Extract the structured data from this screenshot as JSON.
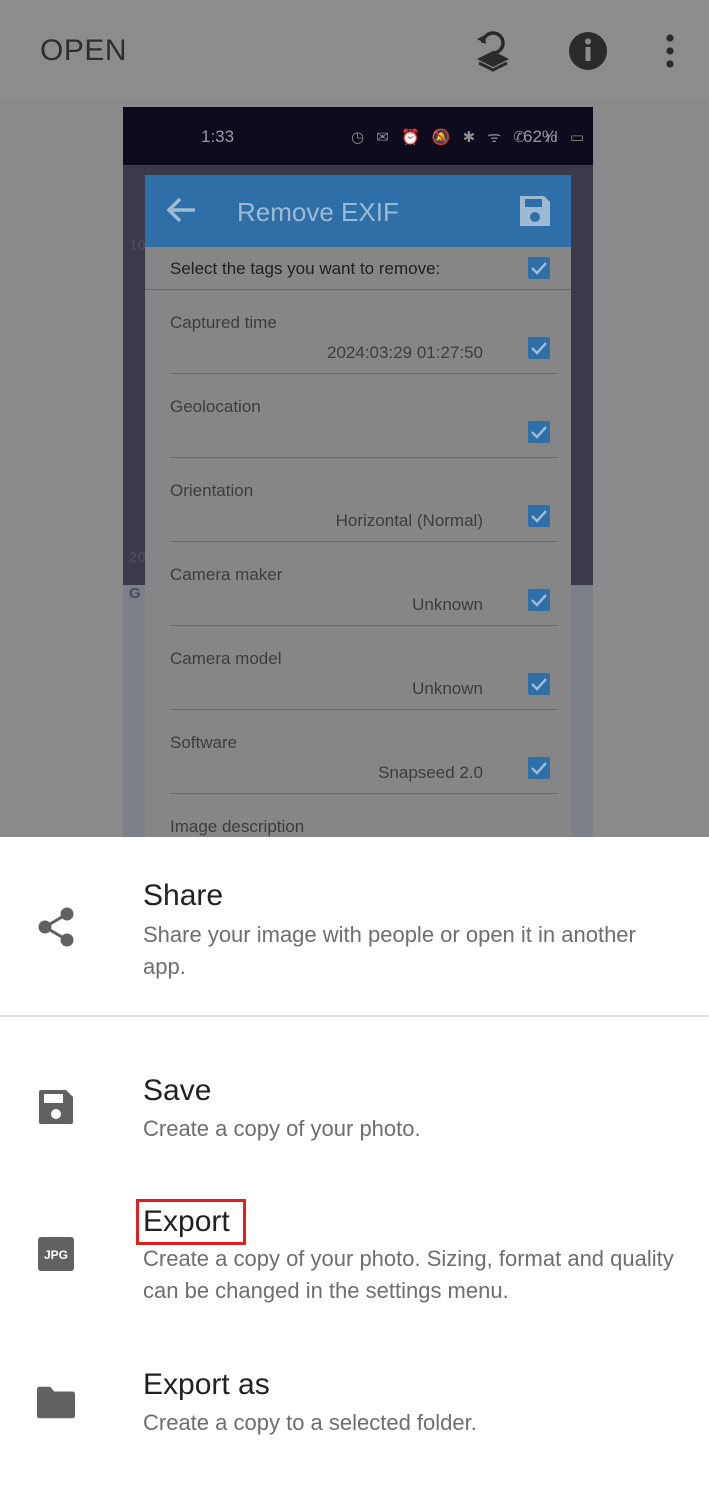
{
  "toolbar": {
    "open_label": "OPEN",
    "icons": [
      "layers-undo-icon",
      "info-icon",
      "more-vert-icon"
    ]
  },
  "phone": {
    "time": "1:33",
    "status_icons": "◷ ✉   ⏰ 🔕 ✱ ᯤ ✆ .ıl ▭",
    "battery": "62%"
  },
  "dialog": {
    "title": "Remove EXIF",
    "subtitle": "Select the tags you want to remove:",
    "tags": [
      {
        "label": "Captured time",
        "value": "2024:03:29 01:27:50"
      },
      {
        "label": "Geolocation",
        "value": ""
      },
      {
        "label": "Orientation",
        "value": "Horizontal (Normal)"
      },
      {
        "label": "Camera maker",
        "value": "Unknown"
      },
      {
        "label": "Camera model",
        "value": "Unknown"
      },
      {
        "label": "Software",
        "value": "Snapseed 2.0"
      },
      {
        "label": "Image description",
        "value": ""
      }
    ],
    "side_labels": [
      "10",
      "20",
      "G"
    ]
  },
  "sheet": {
    "options": [
      {
        "title": "Share",
        "desc": "Share your image with people or open it in another app.",
        "icon": "share-icon"
      },
      {
        "title": "Save",
        "desc": "Create a copy of your photo.",
        "icon": "save-icon"
      },
      {
        "title": "Export",
        "desc": "Create a copy of your photo. Sizing, format and quality can be changed in the settings menu.",
        "icon": "jpg-icon",
        "icon_text": "JPG"
      },
      {
        "title": "Export as",
        "desc": "Create a copy to a selected folder.",
        "icon": "folder-icon"
      }
    ]
  },
  "colors": {
    "accent": "#2e6fa8",
    "highlight": "#e02020",
    "scrim": "#8a8a8a",
    "sheet_bg": "#ffffff"
  }
}
